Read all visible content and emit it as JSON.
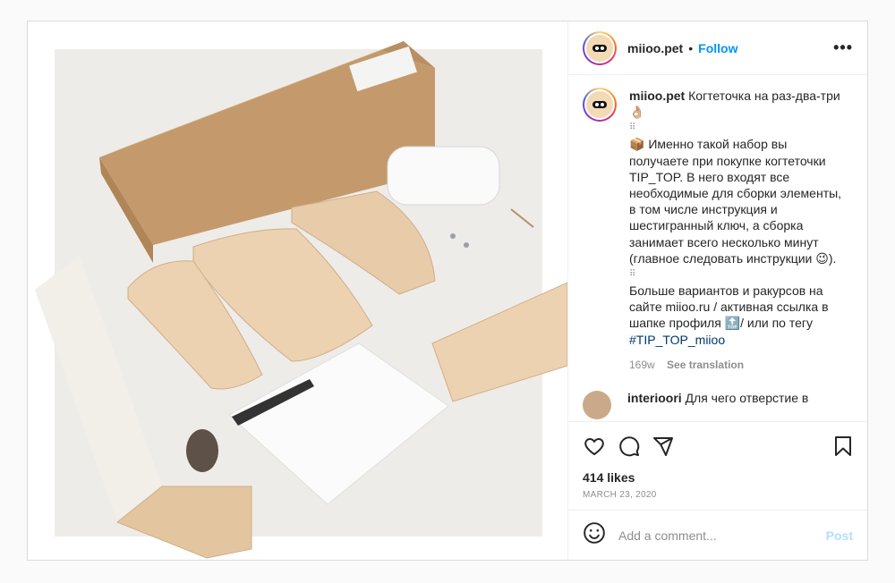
{
  "post": {
    "username": "miioo.pet",
    "follow_label": "Follow",
    "more_label": "•••",
    "separator": "•",
    "caption_line1": "Когтеточка на раз-два-три 👌🏼",
    "caption_dots": "⠿",
    "caption_para2": "📦 Именно такой набор вы получаете при покупке когтеточки TIP_TOP. В него входят все необходимые для сборки элементы, в том числе инструкция и шестигранный ключ, а сборка занимает всего несколько минут (главное следовать инструкции 😉).",
    "caption_para3": "Больше вариантов и ракурсов на сайте miioo.ru / активная ссылка в шапке профиля 🔝/ или по тегу",
    "hashtag": "#TIP_TOP_miioo",
    "age": "169w",
    "see_translation": "See translation",
    "comment_user": "interioori",
    "comment_text": "Для чего отверстие в",
    "likes": "414 likes",
    "date": "MARCH 23, 2020",
    "add_comment_placeholder": "Add a comment...",
    "post_label": "Post"
  },
  "icons": {
    "like": "heart-icon",
    "comment": "comment-icon",
    "share": "paper-plane-icon",
    "save": "bookmark-icon",
    "emoji": "smiley-icon"
  },
  "colors": {
    "link": "#0095f6",
    "hashtag": "#00376b",
    "muted": "#8e8e8e",
    "post_disabled": "#b2dffc"
  }
}
